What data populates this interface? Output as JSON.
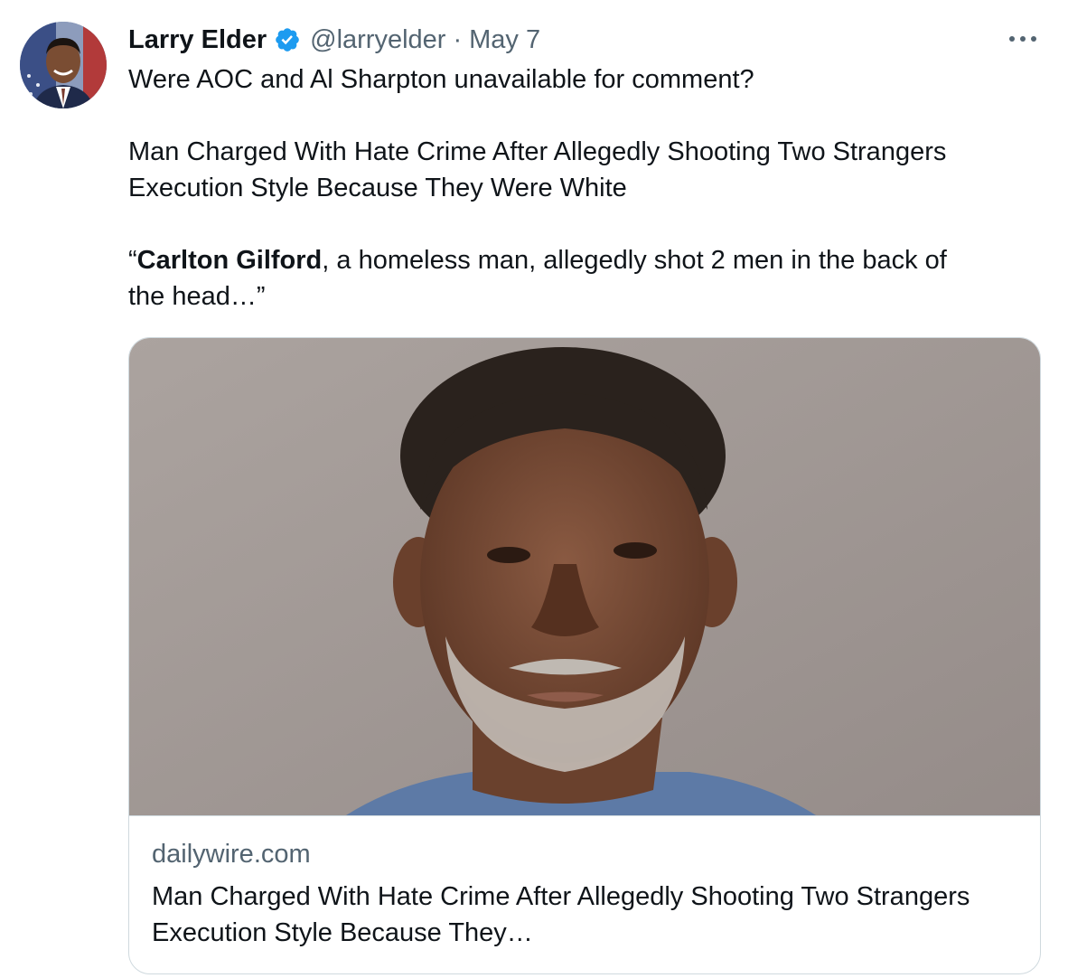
{
  "author": {
    "name": "Larry Elder",
    "handle": "@larryelder",
    "date": "May 7",
    "verified_icon": "verified-badge-icon"
  },
  "tweet": {
    "line1": "Were AOC and Al Sharpton unavailable for comment?",
    "headline_line1": "Man Charged With Hate Crime After Allegedly Shooting Two Strangers",
    "headline_line2": "Execution Style Because They Were White",
    "quote_open": "“",
    "quote_bold": "Carlton Gilford",
    "quote_rest_line1": ", a homeless man, allegedly shot 2 men in the back of",
    "quote_line2": "the head…”"
  },
  "card": {
    "domain": "dailywire.com",
    "title_line1": "Man Charged With Hate Crime After Allegedly Shooting Two Strangers",
    "title_line2": "Execution Style Because They…"
  },
  "colors": {
    "accent_verified": "#1d9bf0",
    "muted_text": "#536471",
    "border": "#cfd9de"
  }
}
